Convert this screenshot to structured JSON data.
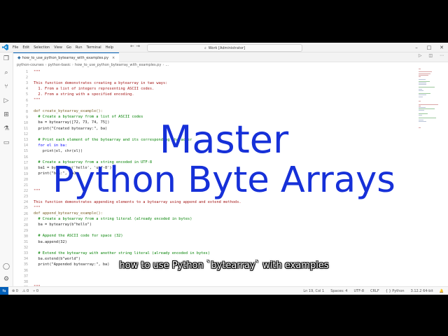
{
  "window": {
    "menus": [
      "File",
      "Edit",
      "Selection",
      "View",
      "Go",
      "Run",
      "Terminal",
      "Help"
    ],
    "command_center": "Work [Administrator]",
    "controls": {
      "minimize": "–",
      "maximize": "□",
      "close": "✕"
    }
  },
  "tab": {
    "label": "how_to_use_python_bytearray_with_examples.py",
    "close": "×"
  },
  "breadcrumb": [
    "python-courses",
    "python-basic",
    "how_to_use_python_bytearray_with_examples.py",
    "..."
  ],
  "editor": {
    "lines": [
      {
        "n": "1",
        "text": "\"\"\"",
        "cls": "c-str"
      },
      {
        "n": "2",
        "text": "",
        "cls": "c-str"
      },
      {
        "n": "3",
        "text": "This function demonstrates creating a bytearray in two ways:",
        "cls": "c-str"
      },
      {
        "n": "4",
        "text": "  1. From a list of integers representing ASCII codes.",
        "cls": "c-str"
      },
      {
        "n": "5",
        "text": "  2. From a string with a specified encoding.",
        "cls": "c-str"
      },
      {
        "n": "6",
        "text": "\"\"\"",
        "cls": "c-str"
      },
      {
        "n": "7",
        "text": "",
        "cls": "c-txt"
      },
      {
        "n": "8",
        "text": "def create_bytearray_example():",
        "cls": "c-def"
      },
      {
        "n": "9",
        "text": "  # Create a bytearray from a list of ASCII codes",
        "cls": "c-com"
      },
      {
        "n": "10",
        "text": "  ba = bytearray([72, 73, 74, 75])",
        "cls": "c-txt"
      },
      {
        "n": "11",
        "text": "  print(\"Created bytearray:\", ba)",
        "cls": "c-txt"
      },
      {
        "n": "12",
        "text": "",
        "cls": "c-txt"
      },
      {
        "n": "13",
        "text": "  # Print each element of the bytearray and its corresponding character",
        "cls": "c-com"
      },
      {
        "n": "14",
        "text": "  for el in ba:",
        "cls": "c-kw"
      },
      {
        "n": "15",
        "text": "    print(el, chr(el))",
        "cls": "c-txt"
      },
      {
        "n": "16",
        "text": "",
        "cls": "c-txt"
      },
      {
        "n": "17",
        "text": "  # Create a bytearray from a string encoded in UTF-8",
        "cls": "c-com"
      },
      {
        "n": "18",
        "text": "  ba1 = bytearray('hello', 'utf-8')",
        "cls": "c-txt"
      },
      {
        "n": "19",
        "text": "  print(\"ba1:\", ba1)",
        "cls": "c-txt"
      },
      {
        "n": "20",
        "text": "",
        "cls": "c-txt"
      },
      {
        "n": "21",
        "text": "",
        "cls": "c-txt"
      },
      {
        "n": "22",
        "text": "\"\"\"",
        "cls": "c-str"
      },
      {
        "n": "23",
        "text": "",
        "cls": "c-str"
      },
      {
        "n": "24",
        "text": "This function demonstrates appending elements to a bytearray using append and extend methods.",
        "cls": "c-str"
      },
      {
        "n": "25",
        "text": "\"\"\"",
        "cls": "c-str"
      },
      {
        "n": "26",
        "text": "def append_bytearray_example():",
        "cls": "c-def"
      },
      {
        "n": "27",
        "text": "  # Create a bytearray from a string literal (already encoded in bytes)",
        "cls": "c-com"
      },
      {
        "n": "28",
        "text": "  ba = bytearray(b\"hello\")",
        "cls": "c-txt"
      },
      {
        "n": "29",
        "text": "",
        "cls": "c-txt"
      },
      {
        "n": "30",
        "text": "  # Append the ASCII code for space (32)",
        "cls": "c-com"
      },
      {
        "n": "31",
        "text": "  ba.append(32)",
        "cls": "c-txt"
      },
      {
        "n": "32",
        "text": "",
        "cls": "c-txt"
      },
      {
        "n": "33",
        "text": "  # Extend the bytearray with another string literal (already encoded in bytes)",
        "cls": "c-com"
      },
      {
        "n": "34",
        "text": "  ba.extend(b\"world\")",
        "cls": "c-txt"
      },
      {
        "n": "35",
        "text": "  print(\"Appended bytearray:\", ba)",
        "cls": "c-txt"
      },
      {
        "n": "36",
        "text": "",
        "cls": "c-txt"
      },
      {
        "n": "37",
        "text": "",
        "cls": "c-txt"
      },
      {
        "n": "38",
        "text": "",
        "cls": "c-txt"
      },
      {
        "n": "39",
        "text": "\"\"\"",
        "cls": "c-str"
      }
    ]
  },
  "overlay": {
    "title_line1": "Master",
    "title_line2": "Python Byte Arrays",
    "subtitle": "how to use Python `bytearray` with examples",
    "color": "#1630d8"
  },
  "statusbar": {
    "remote": "⇆",
    "errors": "⊗ 0",
    "warnings": "⚠ 0",
    "ports": "⑂ 0",
    "position": "Ln 19, Col 1",
    "spaces": "Spaces: 4",
    "encoding": "UTF-8",
    "eol": "CRLF",
    "language": "{ } Python",
    "interpreter": "3.12.2 64-bit",
    "bell": "🔔"
  },
  "colors": {
    "accent": "#005fb8",
    "string": "#a31515",
    "comment": "#008000",
    "keyword": "#0000ff"
  }
}
